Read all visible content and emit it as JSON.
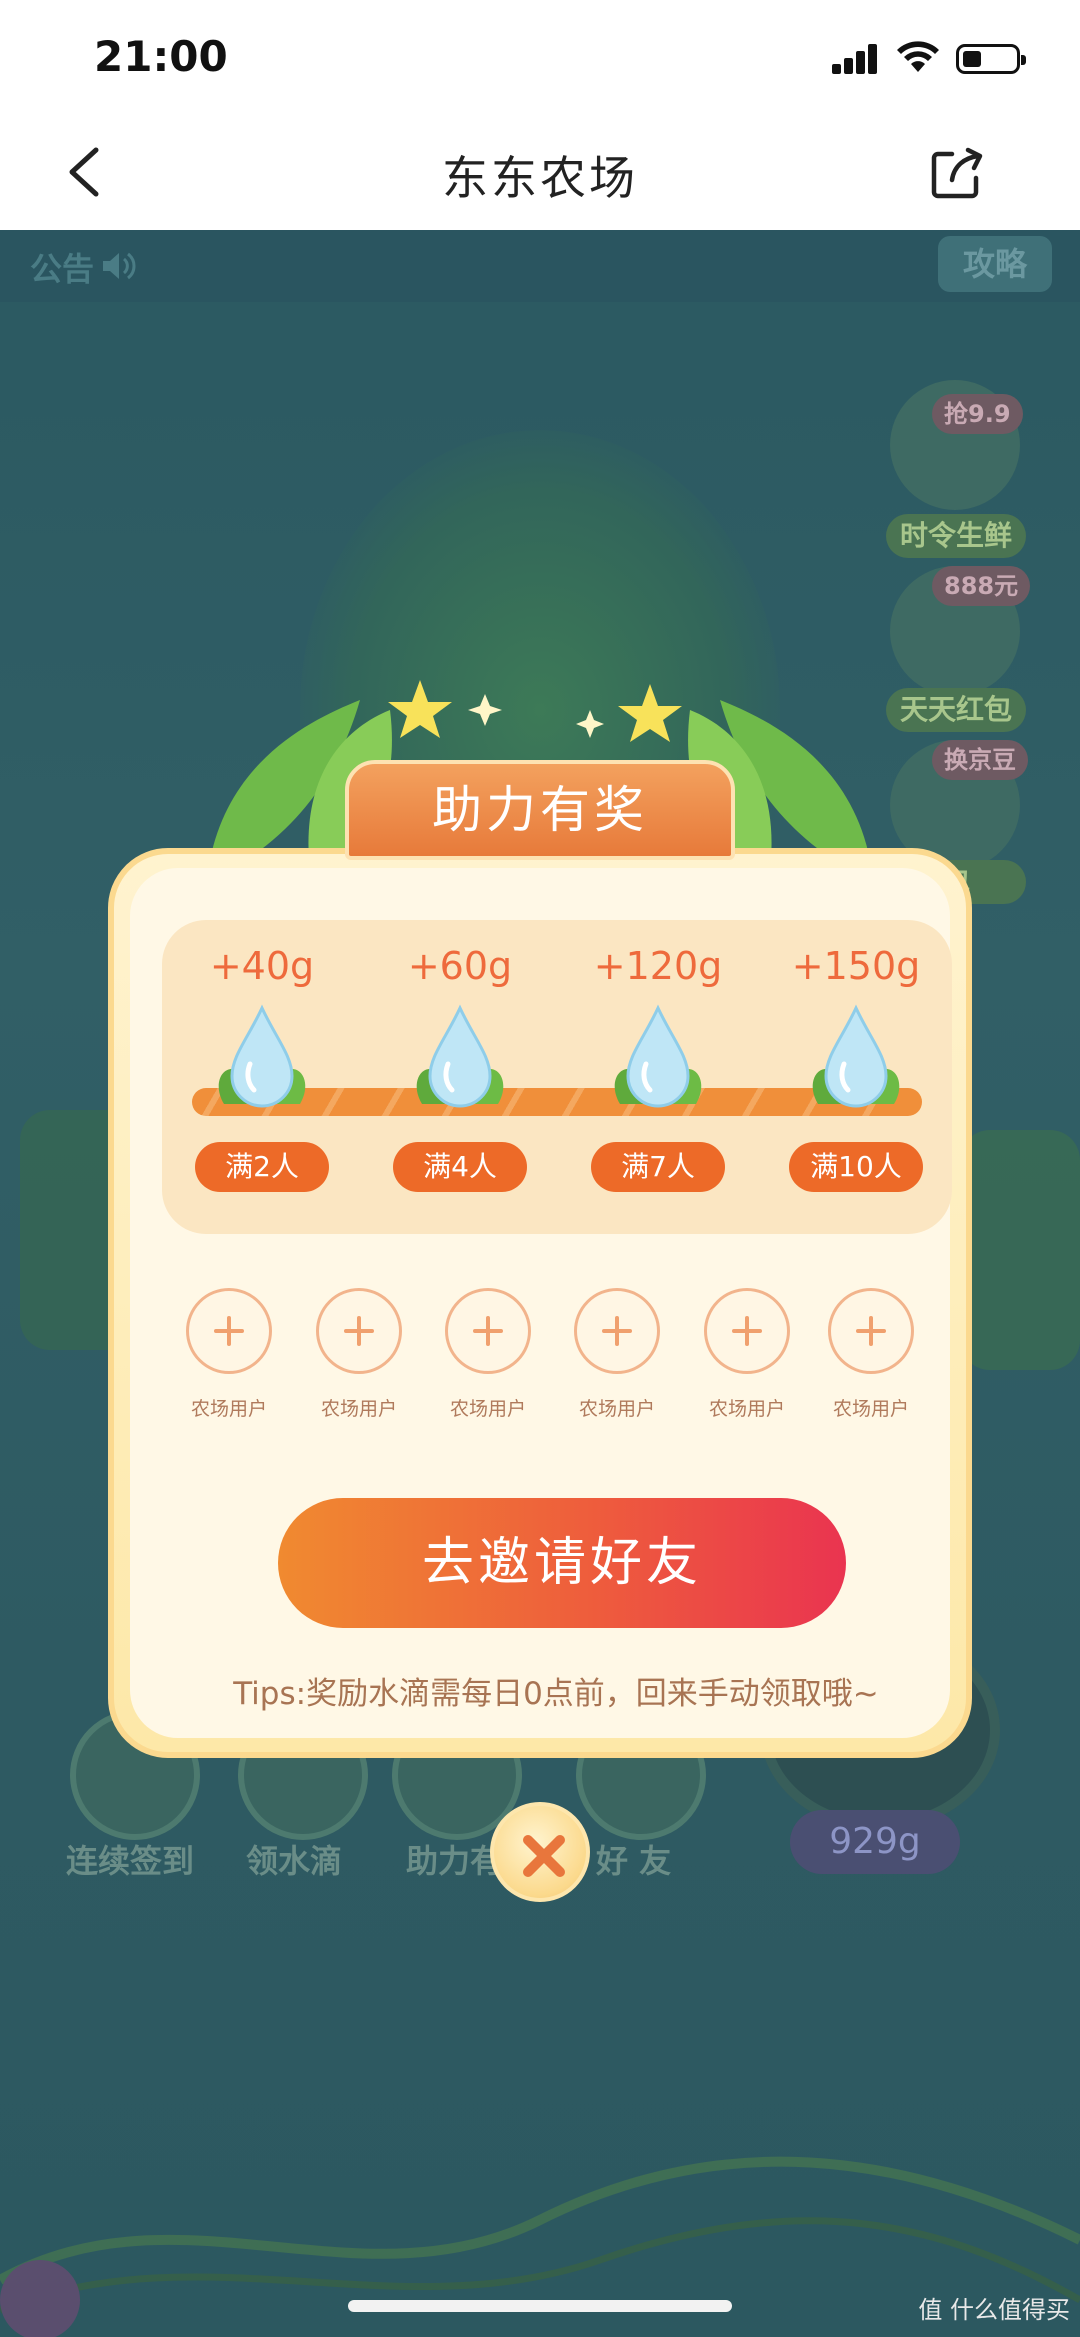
{
  "status_bar": {
    "time": "21:00"
  },
  "nav": {
    "title": "东东农场"
  },
  "game": {
    "notice_label": "公告",
    "strategy_label": "攻略",
    "side_items": [
      {
        "badge": "抢9.9",
        "label": "时令生鲜"
      },
      {
        "badge": "888元",
        "label": "天天红包"
      },
      {
        "badge": "换京豆",
        "label": "包"
      }
    ],
    "bottom_items": [
      "连续签到",
      "领水滴",
      "助力有",
      "好 友"
    ],
    "water_total": "929g"
  },
  "modal": {
    "title": "助力有奖",
    "rewards": [
      {
        "amount": "+40g",
        "tier": "满2人"
      },
      {
        "amount": "+60g",
        "tier": "满4人"
      },
      {
        "amount": "+120g",
        "tier": "满7人"
      },
      {
        "amount": "+150g",
        "tier": "满10人"
      }
    ],
    "slots": [
      "农场用户",
      "农场用户",
      "农场用户",
      "农场用户",
      "农场用户",
      "农场用户"
    ],
    "invite_button": "去邀请好友",
    "tips": "Tips:奖励水滴需每日0点前，回来手动领取哦~"
  },
  "watermark": "值 什么值得买",
  "colors": {
    "accent": "#ee6a3c",
    "button_start": "#f08a30",
    "button_end": "#ea3450",
    "modal_bg": "#fff8e6"
  }
}
